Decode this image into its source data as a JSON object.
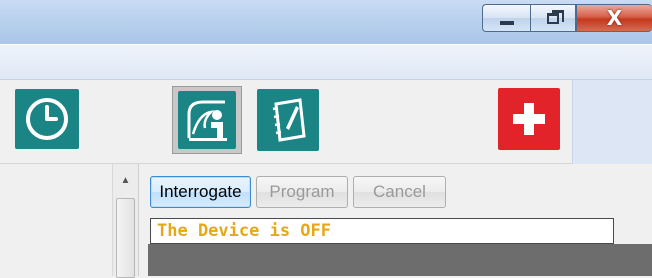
{
  "window": {
    "controls": {
      "minimize_icon": "minimize-icon",
      "maximize_icon": "restore-icon",
      "close_label": "X"
    }
  },
  "toolbar": {
    "icons": [
      {
        "name": "clock-icon",
        "color": "#1b8485"
      },
      {
        "name": "interrogate-icon",
        "color": "#1b8485",
        "selected": true
      },
      {
        "name": "notes-icon",
        "color": "#1b8485"
      },
      {
        "name": "plus-icon",
        "color": "#e2232a"
      }
    ]
  },
  "actions": {
    "interrogate_label": "Interrogate",
    "program_label": "Program",
    "cancel_label": "Cancel"
  },
  "status": {
    "text": "The Device is OFF",
    "color": "#e6a817"
  }
}
